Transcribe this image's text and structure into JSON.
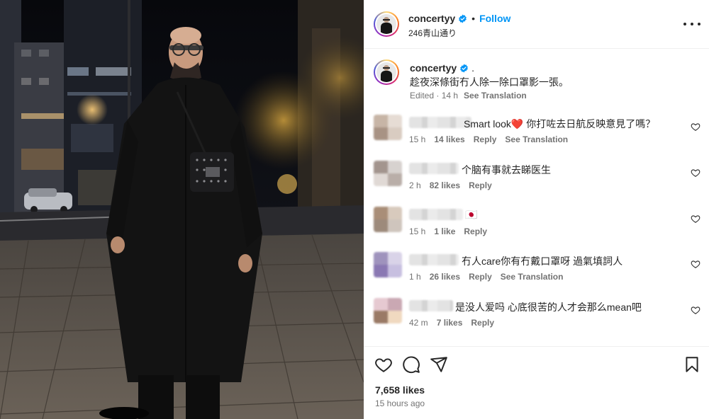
{
  "post": {
    "username": "concertyy",
    "follow_label": "Follow",
    "location": "246青山通り",
    "more_icon": "more-horizontal-icon"
  },
  "caption": {
    "username": "concertyy",
    "trailing": ".",
    "text": "趁夜深條街冇人除一除口罩影一張。",
    "edited": "Edited · 14 h",
    "see_translation": "See Translation"
  },
  "comments": [
    {
      "text": "Smart look",
      "emoji": "❤️",
      "text_after": " 你打咗去日航反映意見了嗎？",
      "time": "15 h",
      "likes": "14 likes",
      "reply": "Reply",
      "see_translation": "See Translation"
    },
    {
      "text": "个脑有事就去睇医生",
      "time": "2 h",
      "likes": "82 likes",
      "reply": "Reply"
    },
    {
      "text": "🇯🇵",
      "time": "15 h",
      "likes": "1 like",
      "reply": "Reply"
    },
    {
      "text": "冇人care你有冇戴口罩呀 過氣填詞人",
      "time": "1 h",
      "likes": "26 likes",
      "reply": "Reply",
      "see_translation": "See Translation"
    },
    {
      "text": "是没人爱吗 心底很苦的人才会那么mean吧",
      "time": "42 m",
      "likes": "7 likes",
      "reply": "Reply"
    }
  ],
  "footer": {
    "likes": "7,658 likes",
    "time_ago": "15 hours ago",
    "icons": [
      "heart-icon",
      "comment-icon",
      "share-icon",
      "bookmark-icon"
    ]
  },
  "colors": {
    "link": "#0095f6",
    "verified": "#0095f6",
    "secondary_text": "#737373",
    "heart_emoji": "#e0245e"
  }
}
